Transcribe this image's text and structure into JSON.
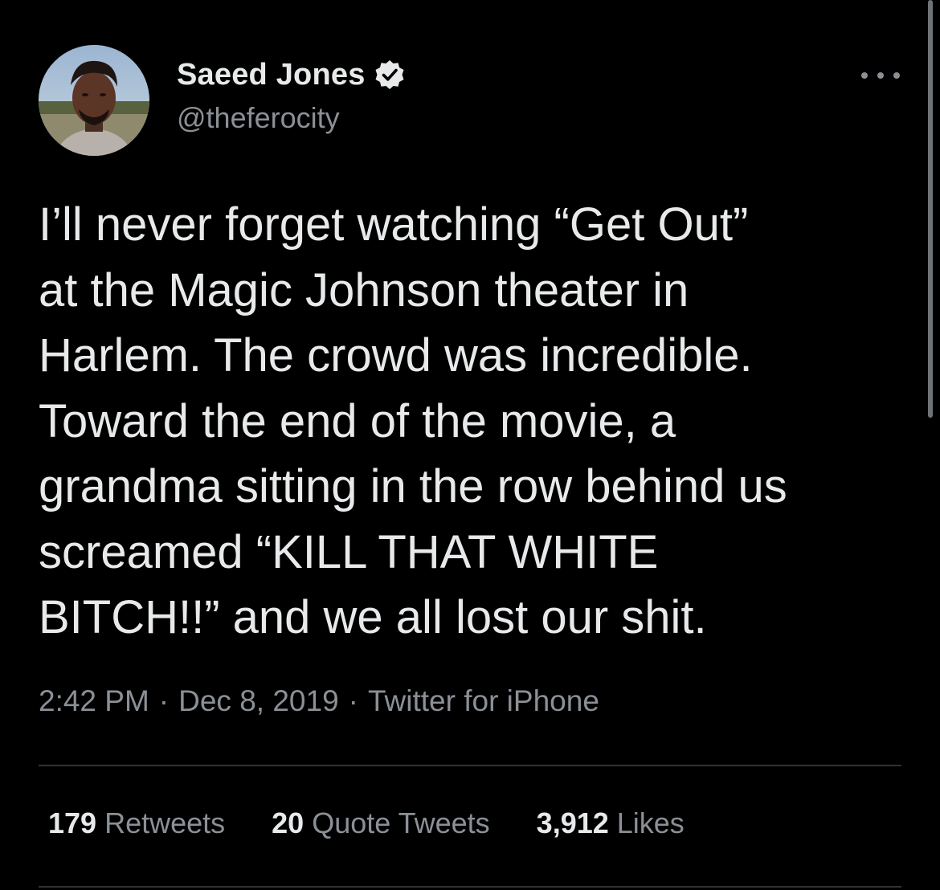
{
  "author": {
    "display_name": "Saeed Jones",
    "handle": "@theferocity",
    "verified": true
  },
  "tweet": {
    "lines": [
      "I’ll never forget watching “Get Out”",
      "at the Magic Johnson theater in",
      "Harlem. The crowd was incredible.",
      "Toward the end of the movie, a",
      "grandma sitting in the row behind us",
      "screamed “KILL THAT WHITE",
      "BITCH!!” and we all lost our shit."
    ],
    "time": "2:42 PM",
    "date": "Dec 8, 2019",
    "source": "Twitter for iPhone"
  },
  "stats": {
    "retweets_count": "179",
    "retweets_label": "Retweets",
    "quotes_count": "20",
    "quotes_label": "Quote Tweets",
    "likes_count": "3,912",
    "likes_label": "Likes"
  },
  "icons": {
    "verified": "verified-badge-icon",
    "more": "more-options-icon"
  },
  "colors": {
    "background": "#000000",
    "text": "#e7e9ea",
    "secondary": "#8b9096",
    "divider": "#2f3336"
  }
}
